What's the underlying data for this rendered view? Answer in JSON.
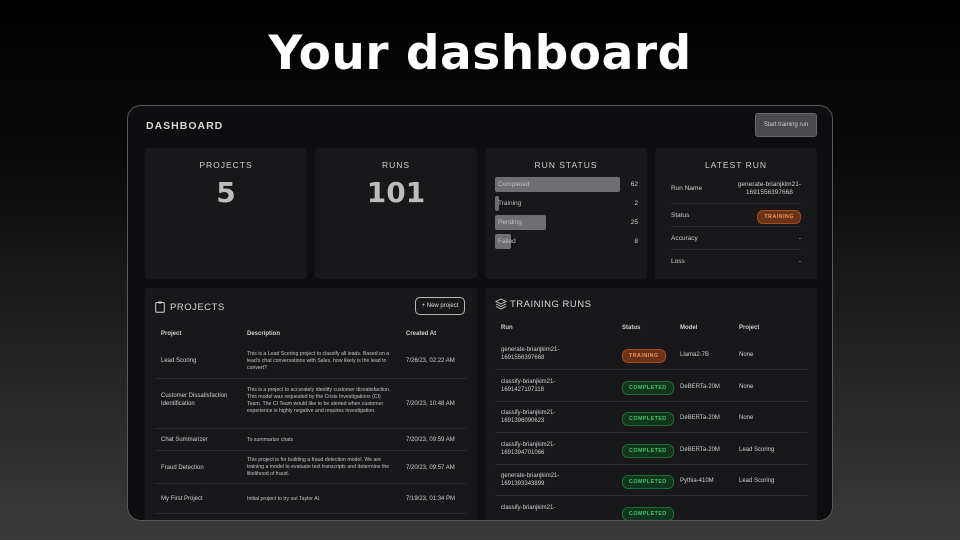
{
  "headline": "Your dashboard",
  "dashboard": {
    "title": "DASHBOARD",
    "start_button": "Start training run"
  },
  "stats": {
    "projects_label": "PROJECTS",
    "projects_value": "5",
    "runs_label": "RUNS",
    "runs_value": "101"
  },
  "run_status": {
    "title": "RUN STATUS",
    "items": [
      {
        "name": "Completed",
        "count": "62",
        "fraction": 1.0
      },
      {
        "name": "Training",
        "count": "2",
        "fraction": 0.03
      },
      {
        "name": "Pending",
        "count": "25",
        "fraction": 0.41
      },
      {
        "name": "Failed",
        "count": "8",
        "fraction": 0.13
      }
    ]
  },
  "latest_run": {
    "title": "LATEST RUN",
    "rows": [
      {
        "key": "Run Name",
        "value": "generate-brianjkim21-\n1691556397668"
      },
      {
        "key": "Status",
        "value": "TRAINING"
      },
      {
        "key": "Accuracy",
        "value": "-"
      },
      {
        "key": "Loss",
        "value": "-"
      }
    ]
  },
  "projects": {
    "title": "PROJECTS",
    "new_button": "+ New project",
    "headers": [
      "Project",
      "Description",
      "Created At"
    ],
    "rows": [
      {
        "project": "Lead Scoring",
        "description": "This is a Lead Scoring project to classify all leads. Based on a lead's chat conversations with Sales, how likely is the lead to convert?",
        "created": "7/26/23, 02:22 AM"
      },
      {
        "project": "Customer Dissatisfaction Identification",
        "description": "This is a project to accurately identify customer dissatisfaction. This model was requested by the Crisis Investigations (CI) Team. The CI Team would like to be alerted when customer experience is highly negative and requires investigation.",
        "created": "7/20/23, 10:48 AM"
      },
      {
        "project": "Chat Summarizer",
        "description": "To summarize chats",
        "created": "7/20/23, 09:59 AM"
      },
      {
        "project": "Fraud Detection",
        "description": "This project is for building a fraud detection model. We are training a model to evaluate text transcripts and determine the likelihood of fraud.",
        "created": "7/20/23, 09:57 AM"
      },
      {
        "project": "My First Project",
        "description": "Initial project to try out Taylor AI.",
        "created": "7/19/23, 01:34 PM"
      }
    ]
  },
  "training_runs": {
    "title": "TRAINING RUNS",
    "headers": [
      "Run",
      "Status",
      "Model",
      "Project"
    ],
    "rows": [
      {
        "run": "generate-brianjkim21-\n1691556397668",
        "status": "TRAINING",
        "model": "Llama2-7B",
        "project": "None"
      },
      {
        "run": "classify-brianjkim21-\n1691427107118",
        "status": "COMPLETED",
        "model": "DeBERTa-20M",
        "project": "None"
      },
      {
        "run": "classify-brianjkim21-\n1691396090623",
        "status": "COMPLETED",
        "model": "DeBERTa-20M",
        "project": "None"
      },
      {
        "run": "classify-brianjkim21-\n1691394701066",
        "status": "COMPLETED",
        "model": "DeBERTa-20M",
        "project": "Lead Scoring"
      },
      {
        "run": "generate-brianjkim21-\n1691393343899",
        "status": "COMPLETED",
        "model": "Pythia-410M",
        "project": "Lead Scoring"
      },
      {
        "run": "classify-brianjkim21-",
        "status": "COMPLETED",
        "model": "",
        "project": ""
      }
    ]
  },
  "colors": {
    "training_badge": "#f0945a",
    "completed_badge": "#46c46a",
    "card_bg": "#18181b"
  }
}
